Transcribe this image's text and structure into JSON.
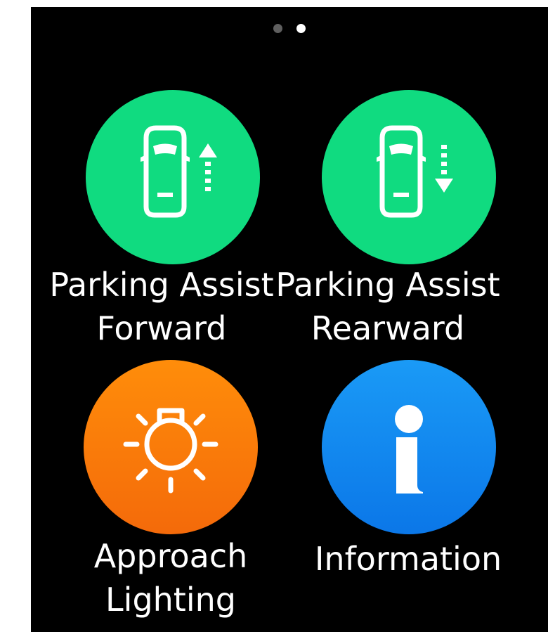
{
  "pager": {
    "pages": 2,
    "current": 2
  },
  "tiles": [
    {
      "label_line1": "Parking Assist",
      "label_line2": "Forward",
      "icon": "car-forward-arrow-icon",
      "color": "#10db80"
    },
    {
      "label_line1": "Parking Assist",
      "label_line2": "Rearward",
      "icon": "car-rearward-arrow-icon",
      "color": "#10db80"
    },
    {
      "label_line1": "Approach",
      "label_line2": "Lighting",
      "icon": "light-bulb-rays-icon",
      "color": "#f97a0a"
    },
    {
      "label_line1": "Information",
      "label_line2": "",
      "icon": "info-icon",
      "color": "#128af0"
    }
  ]
}
